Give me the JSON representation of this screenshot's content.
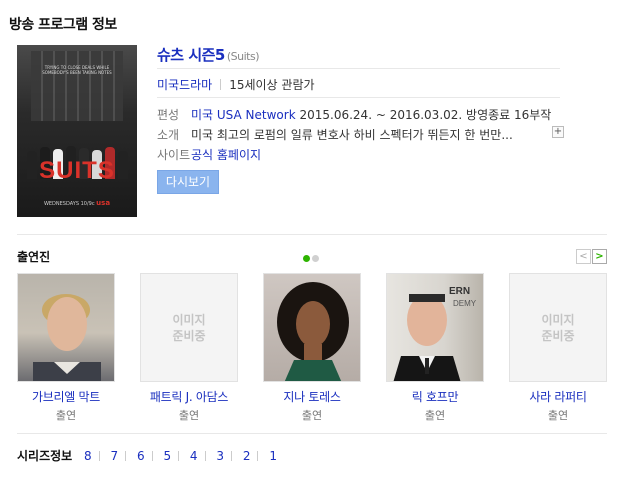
{
  "section_title": "방송 프로그램 정보",
  "poster": {
    "logo_text": "SUITS",
    "network_mark": "usa",
    "tagline": "WEDNESDAYS 10/9c",
    "top_text": "TRYING TO CLOSE DEALS WHILE SOMEBODY'S BEEN TAKING NOTES"
  },
  "show": {
    "title": "슈츠 시즌5",
    "original_title": "(Suits)",
    "genre": "미국드라마",
    "rating": "15세이상 관람가"
  },
  "details": {
    "schedule_label": "편성",
    "schedule_link": "미국 USA Network",
    "schedule_value": "2015.06.24. ~ 2016.03.02. 방영종료 16부작",
    "intro_label": "소개",
    "intro_value": "미국 최고의 로펌의 일류 변호사 하비 스펙터가 뛰든지 한 번만...",
    "site_label": "사이트",
    "site_link": "공식 홈페이지",
    "expand_symbol": "+"
  },
  "rewatch_label": "다시보기",
  "cast": {
    "title": "출연진",
    "prev_symbol": "<",
    "next_symbol": ">",
    "page_dots_total": 2,
    "page_dot_active": 1,
    "active_color": "#2db400",
    "members": [
      {
        "name": "가브리엘 막트",
        "role": "출연",
        "has_photo": true
      },
      {
        "name": "패트릭 J. 아담스",
        "role": "출연",
        "has_photo": false,
        "placeholder": "이미지\n준비중"
      },
      {
        "name": "지나 토레스",
        "role": "출연",
        "has_photo": true
      },
      {
        "name": "릭 호프만",
        "role": "출연",
        "has_photo": true
      },
      {
        "name": "사라 라퍼티",
        "role": "출연",
        "has_photo": false,
        "placeholder": "이미지\n준비중"
      }
    ]
  },
  "series": {
    "label": "시리즈정보",
    "seasons": [
      "8",
      "7",
      "6",
      "5",
      "4",
      "3",
      "2",
      "1"
    ]
  }
}
